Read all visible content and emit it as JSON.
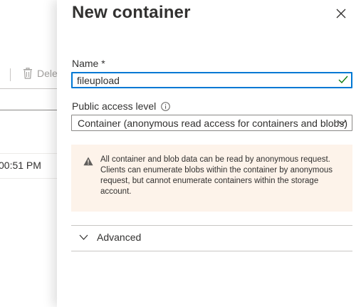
{
  "background": {
    "delete_label": "Dele",
    "row_time": "00:51 PM"
  },
  "panel": {
    "title": "New container",
    "name_label": "Name *",
    "name_value": "fileupload",
    "access_label": "Public access level",
    "access_value": "Container (anonymous read access for containers and blobs)",
    "warning_text": "All container and blob data can be read by anonymous request. Clients can enumerate blobs within the container by anonymous request, but cannot enumerate containers within the storage account.",
    "advanced_label": "Advanced"
  },
  "icons": {
    "delete": "trash-icon",
    "close": "close-icon",
    "check": "check-icon",
    "info": "info-icon",
    "chevron": "chevron-down-icon",
    "warning": "warning-icon"
  },
  "colors": {
    "accent": "#0078d4",
    "warning_bg": "#fdf3ea"
  }
}
